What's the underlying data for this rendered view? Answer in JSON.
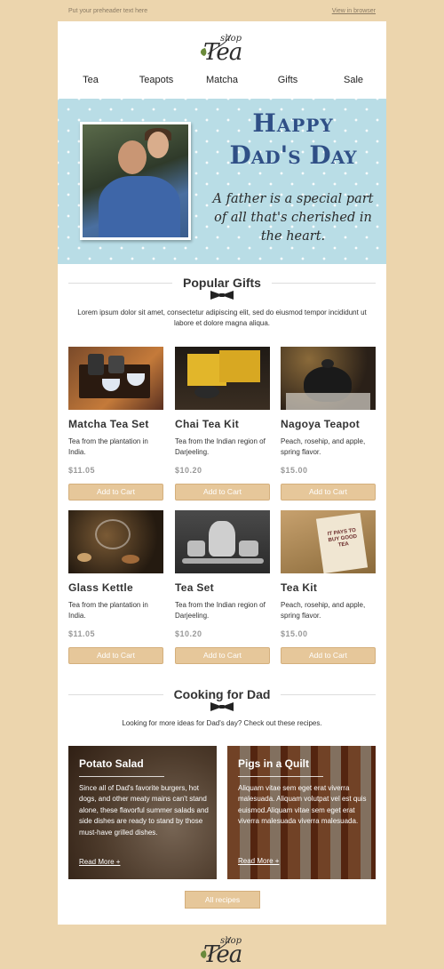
{
  "preheader": {
    "text": "Put your preheader text here",
    "view_link": "View in browser"
  },
  "logo": {
    "shop": "shop",
    "tea": "Tea"
  },
  "nav": [
    "Tea",
    "Teapots",
    "Matcha",
    "Gifts",
    "Sale"
  ],
  "hero": {
    "title_line1": "Happy",
    "title_line2": "Dad's Day",
    "quote": "A father is a special part of all that's cherished in the heart."
  },
  "popular": {
    "heading": "Popular Gifts",
    "intro": "Lorem ipsum dolor sit amet, consectetur adipiscing elit, sed do eiusmod tempor incididunt ut labore et dolore magna aliqua.",
    "products": [
      {
        "name": "Matcha Tea Set",
        "desc": "Tea from the plantation in India.",
        "price": "$11.05",
        "button": "Add to Cart"
      },
      {
        "name": "Chai Tea Kit",
        "desc": "Tea from the Indian region of Darjeeling.",
        "price": "$10.20",
        "button": "Add to Cart"
      },
      {
        "name": "Nagoya Teapot",
        "desc": "Peach, rosehip, and apple, spring flavor.",
        "price": "$15.00",
        "button": "Add to Cart"
      },
      {
        "name": "Glass Kettle",
        "desc": "Tea from the plantation in India.",
        "price": "$11.05",
        "button": "Add to Cart"
      },
      {
        "name": "Tea Set",
        "desc": "Tea from the Indian region of Darjeeling.",
        "price": "$10.20",
        "button": "Add to Cart"
      },
      {
        "name": "Tea Kit",
        "desc": "Peach, rosehip, and apple, spring flavor.",
        "price": "$15.00",
        "button": "Add to Cart"
      }
    ],
    "sign_text": "IT PAYS TO BUY GOOD TEA"
  },
  "cooking": {
    "heading": "Cooking for Dad",
    "intro": "Looking for more ideas for Dad's day? Check out these recipes.",
    "recipes": [
      {
        "title": "Potato Salad",
        "text": "Since all of Dad's favorite burgers, hot dogs, and other meaty mains can't stand alone, these flavorful summer salads and side dishes are ready to stand by those must-have grilled dishes.",
        "more": "Read More +"
      },
      {
        "title": "Pigs in a Quilt",
        "text": "Aliquam vitae sem eget erat viverra malesuada. Aliquam volutpat vel est quis euismod.Aliquam vitae sem eget erat viverra malesuada viverra malesuada.",
        "more": "Read More +"
      }
    ],
    "all_button": "All recipes"
  },
  "colors": {
    "background": "#ecd5ad",
    "accent": "#e6c79a",
    "hero": "#b9dde6",
    "title_blue": "#2f4f86"
  }
}
